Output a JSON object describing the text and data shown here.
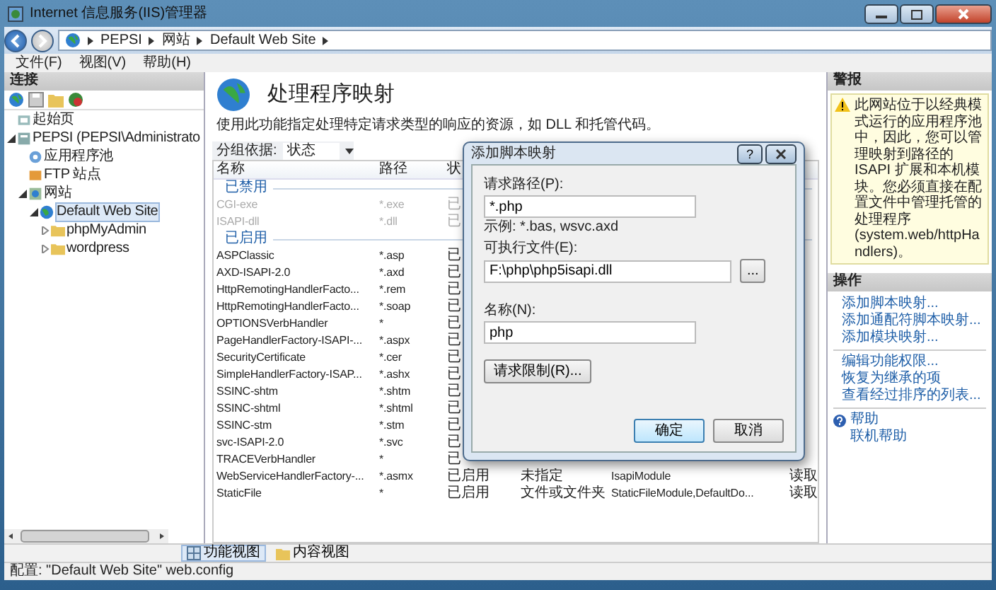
{
  "window": {
    "title": "Internet 信息服务(IIS)管理器"
  },
  "breadcrumb": [
    "PEPSI",
    "网站",
    "Default Web Site"
  ],
  "menu": [
    "文件(F)",
    "视图(V)",
    "帮助(H)"
  ],
  "connections": {
    "title": "连接",
    "tree": [
      {
        "label": "起始页",
        "kind": "home",
        "selected": false
      },
      {
        "label": "PEPSI (PEPSI\\Administrato",
        "kind": "server",
        "expanded": true,
        "selected": false,
        "children": [
          {
            "label": "应用程序池",
            "kind": "pool",
            "selected": false
          },
          {
            "label": "FTP 站点",
            "kind": "ftp",
            "selected": false
          },
          {
            "label": "网站",
            "kind": "sites",
            "expanded": true,
            "selected": false,
            "children": [
              {
                "label": "Default Web Site",
                "kind": "site",
                "expanded": true,
                "selected": true,
                "children": [
                  {
                    "label": "phpMyAdmin",
                    "kind": "folder",
                    "expanded": false,
                    "selected": false
                  },
                  {
                    "label": "wordpress",
                    "kind": "folder",
                    "expanded": false,
                    "selected": false
                  }
                ]
              }
            ]
          }
        ]
      }
    ]
  },
  "feature": {
    "title": "处理程序映射",
    "description": "使用此功能指定处理特定请求类型的响应的资源，如 DLL 和托管代码。",
    "group_by_label": "分组依据:",
    "group_by_value": "状态",
    "columns": [
      "名称",
      "路径",
      "状"
    ],
    "groups": [
      {
        "label": "已禁用",
        "disabled": true,
        "rows": [
          {
            "cells": [
              "CGI-exe",
              "*.exe",
              "已"
            ]
          },
          {
            "cells": [
              "ISAPI-dll",
              "*.dll",
              "已"
            ]
          }
        ]
      },
      {
        "label": "已启用",
        "disabled": false,
        "rows": [
          {
            "cells": [
              "ASPClassic",
              "*.asp",
              "已"
            ]
          },
          {
            "cells": [
              "AXD-ISAPI-2.0",
              "*.axd",
              "已"
            ]
          },
          {
            "cells": [
              "HttpRemotingHandlerFacto...",
              "*.rem",
              "已"
            ]
          },
          {
            "cells": [
              "HttpRemotingHandlerFacto...",
              "*.soap",
              "已"
            ]
          },
          {
            "cells": [
              "OPTIONSVerbHandler",
              "*",
              "已"
            ]
          },
          {
            "cells": [
              "PageHandlerFactory-ISAPI-...",
              "*.aspx",
              "已"
            ]
          },
          {
            "cells": [
              "SecurityCertificate",
              "*.cer",
              "已"
            ]
          },
          {
            "cells": [
              "SimpleHandlerFactory-ISAP...",
              "*.ashx",
              "已"
            ]
          },
          {
            "cells": [
              "SSINC-shtm",
              "*.shtm",
              "已"
            ]
          },
          {
            "cells": [
              "SSINC-shtml",
              "*.shtml",
              "已"
            ]
          },
          {
            "cells": [
              "SSINC-stm",
              "*.stm",
              "已"
            ]
          },
          {
            "cells": [
              "svc-ISAPI-2.0",
              "*.svc",
              "已"
            ]
          },
          {
            "cells": [
              "TRACEVerbHandler",
              "*",
              "已"
            ]
          },
          {
            "cells": [
              "WebServiceHandlerFactory-...",
              "*.asmx",
              "已启用",
              "未指定",
              "IsapiModule",
              "读取"
            ]
          },
          {
            "cells": [
              "StaticFile",
              "*",
              "已启用",
              "文件或文件夹",
              "StaticFileModule,DefaultDo...",
              "读取"
            ]
          }
        ]
      }
    ]
  },
  "view_tabs": [
    {
      "label": "功能视图",
      "selected": true
    },
    {
      "label": "内容视图",
      "selected": false
    }
  ],
  "status_bar": "配置: \"Default Web Site\"  web.config",
  "actions": {
    "alerts_title": "警报",
    "alert": "此网站位于以经典模式运行的应用程序池中，因此，您可以管理映射到路径的 ISAPI 扩展和本机模块。您必须直接在配置文件中管理托管的处理程序 (system.web/httpHandlers)。",
    "operations_title": "操作",
    "link_groups": [
      [
        "添加脚本映射...",
        "添加通配符脚本映射...",
        "添加模块映射..."
      ],
      [
        "编辑功能权限...",
        "恢复为继承的项",
        "查看经过排序的列表..."
      ]
    ],
    "help": [
      "帮助",
      "联机帮助"
    ]
  },
  "dialog": {
    "title": "添加脚本映射",
    "help_button": "?",
    "request_path_label": "请求路径(P):",
    "request_path": "*.php",
    "example": "示例: *.bas, wsvc.axd",
    "executable_label": "可执行文件(E):",
    "executable": "F:\\php\\php5isapi.dll",
    "browse_button": "...",
    "name_label": "名称(N):",
    "name": "php",
    "restrictions_button": "请求限制(R)...",
    "ok_button": "确定",
    "cancel_button": "取消"
  }
}
